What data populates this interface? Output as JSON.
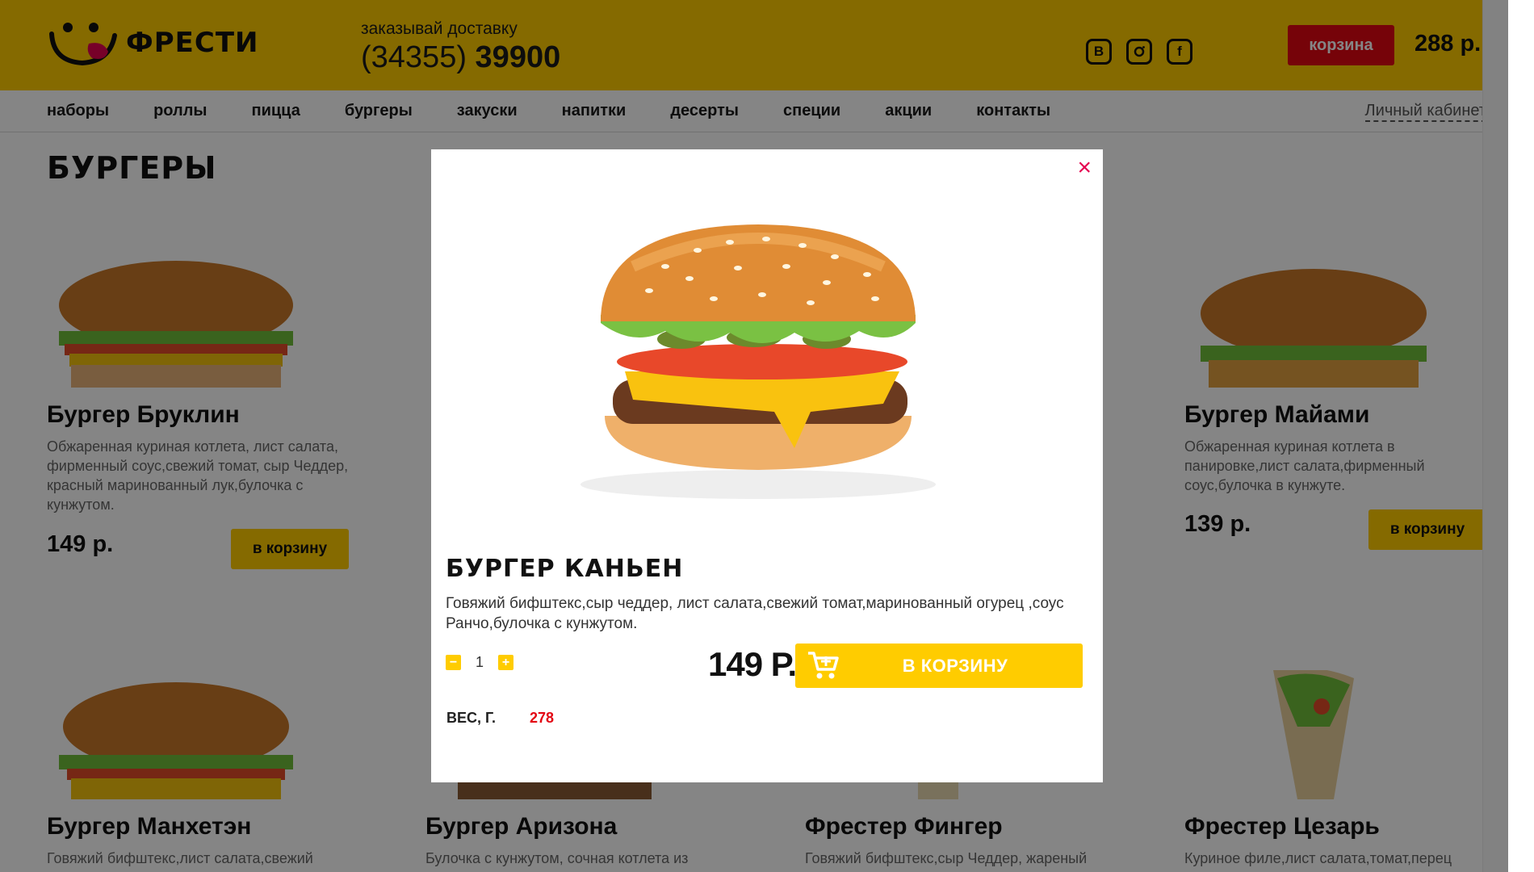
{
  "header": {
    "logo_text": "ФРЕСТИ",
    "delivery_label": "заказывай доставку",
    "phone_code": "(34355)",
    "phone_number": "39900",
    "socials": [
      "B",
      "instagram",
      "f"
    ],
    "cart_label": "корзина",
    "cart_total": "288 р.",
    "colors": {
      "brand_yellow": "#ffcc00",
      "cart_red": "#e30613"
    }
  },
  "nav": {
    "items": [
      "наборы",
      "роллы",
      "пицца",
      "бургеры",
      "закуски",
      "напитки",
      "десерты",
      "специи",
      "акции",
      "контакты"
    ],
    "cabinet": "Личный кабинет"
  },
  "page": {
    "title": "БУРГЕРЫ",
    "products": [
      {
        "name": "Бургер Бруклин",
        "desc": "Обжаренная куриная котлета, лист салата, фирменный соус,свежий томат, сыр Чеддер, красный маринованный лук,булочка с кунжутом.",
        "price": "149 р.",
        "add": "в корзину"
      },
      {
        "name": "Бургер Майами",
        "desc": "Обжаренная куриная котлета в панировке,лист салата,фирменный соус,булочка в кунжуте.",
        "price": "139 р.",
        "add": "в корзину"
      },
      {
        "name": "Бургер Манхетэн",
        "desc": "Говяжий бифштекс,лист салата,свежий"
      },
      {
        "name": "Бургер Аризона",
        "desc": "Булочка с кунжутом, сочная котлета из"
      },
      {
        "name": "Фрестер Фингер",
        "desc": "Говяжий бифштекс,сыр Чеддер, жареный"
      },
      {
        "name": "Фрестер Цезарь",
        "desc": "Куриное филе,лист салата,томат,перец"
      }
    ]
  },
  "modal": {
    "close": "×",
    "title": "БУРГЕР КАНЬЕН",
    "desc": "Говяжий бифштекс,сыр чеддер, лист салата,свежий томат,маринованный огурец ,соус Ранчо,булочка с кунжутом.",
    "qty_minus": "−",
    "qty": "1",
    "qty_plus": "+",
    "price": "149 Р.",
    "add": "В КОРЗИНУ",
    "weight_label": "ВЕС, Г.",
    "weight": "278"
  }
}
